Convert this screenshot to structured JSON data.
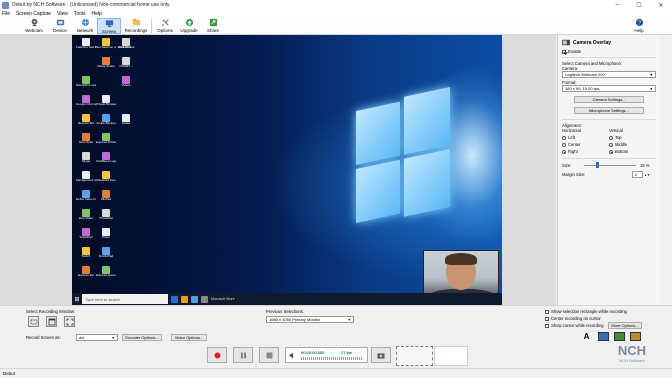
{
  "window": {
    "title": "Debut by NCH Software - (Unlicensed) Non-commercial home use only",
    "controls": {
      "minimize": "–",
      "maximize": "☐",
      "close": "✕"
    }
  },
  "menu": [
    "File",
    "Screen Capture",
    "View",
    "Tools",
    "Help"
  ],
  "toolbar": {
    "items": [
      {
        "label": "Webcam",
        "icon": "webcam-icon"
      },
      {
        "label": "Device",
        "icon": "device-icon"
      },
      {
        "label": "Network",
        "icon": "network-icon"
      },
      {
        "label": "Screen",
        "icon": "screen-icon",
        "active": true
      },
      {
        "label": "Recordings",
        "icon": "recordings-icon"
      },
      {
        "label": "Options",
        "icon": "options-icon"
      },
      {
        "label": "Upgrade",
        "icon": "upgrade-icon"
      },
      {
        "label": "Share",
        "icon": "share-icon"
      }
    ],
    "help_label": "Help"
  },
  "desktop": {
    "icons": [
      "FadeOut Test Explorer",
      "Net Sawmon proven test",
      "AmazonC...",
      "Movie Studio",
      "DiscoDrive Graphics V...",
      "OGMET...",
      "Google Chrome",
      "Private Browser",
      "Recycle Bin",
      "Scribe Backup",
      "NCH Suite",
      "Express Scribe",
      "Skype",
      "ClickBeep Logitech C...",
      "Management Vision",
      "WavePad Sound Editor",
      "Debut Video Capture",
      "MixPad",
      "Zulu Video",
      "PhotoPad",
      "VideoPad",
      "Prism",
      "Switch",
      "DoxilloPad",
      "Express Zip",
      "Express Accounts",
      "2018 Photos",
      "Videos",
      "Folder"
    ],
    "taskbar_search": "Type here to search",
    "taskbar_app": "Microsoft Store"
  },
  "overlay": {
    "title": "Camera Overlay",
    "enable_label": "Enable",
    "enable_checked": true,
    "section_label": "Select Camera and Microphone:",
    "camera_label": "Camera:",
    "camera_value": "Logitech Webcam 200",
    "format_label": "Format:",
    "format_value": "160 x 90, 15.00 fps,",
    "camera_settings": "Camera Settings...",
    "microphone_settings": "Microphone Settings...",
    "alignment_label": "Alignment:",
    "horizontal_label": "Horizontal",
    "vertical_label": "Vertical",
    "h_options": [
      "Left",
      "Center",
      "Right"
    ],
    "v_options": [
      "Top",
      "Middle",
      "Bottom"
    ],
    "h_selected": "Right",
    "v_selected": "Bottom",
    "size_label": "Size:",
    "size_value": "15 %",
    "size_fraction": 0.15,
    "margin_label": "Margin Size:",
    "margin_value": "2"
  },
  "recording": {
    "select_window_label": "Select Recording Window:",
    "prev_label": "Previous Selections:",
    "prev_value": "1680 x 1050 Primary Monitor",
    "opt_show_rect": "Show selection rectangle while recording",
    "opt_center": "Center recording on cursor",
    "opt_cursor": "Show cursor while recording",
    "show_rect_checked": false,
    "center_checked": false,
    "cursor_checked": false,
    "more_options": "More Options...",
    "record_as_label": "Record Screen as:",
    "record_as_value": "avi",
    "encoder_options": "Encoder Options...",
    "video_options": "Video Options..."
  },
  "transport": {
    "time": "00:00:00.000",
    "fps": "27 fps"
  },
  "brand": {
    "name": "NCH Software"
  },
  "status": "Debut"
}
